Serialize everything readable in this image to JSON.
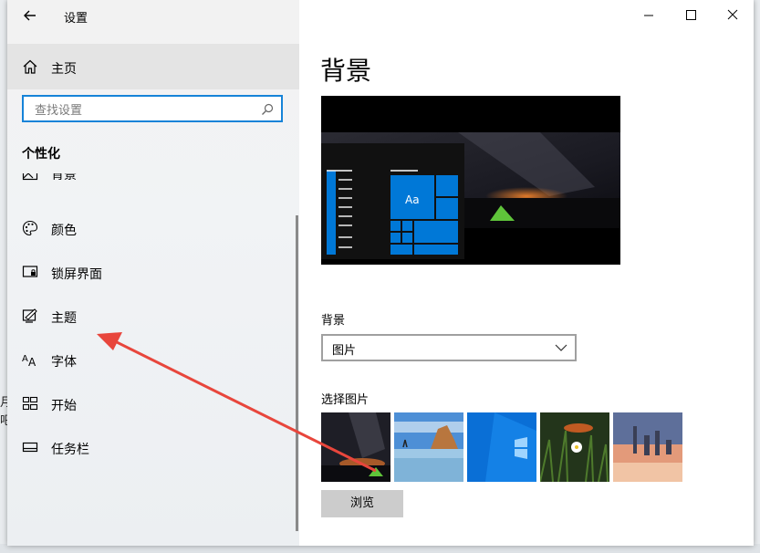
{
  "app": {
    "title": "设置"
  },
  "nav": {
    "home": "主页",
    "section": "个性化",
    "clipped_item": "背景",
    "items": [
      {
        "label": "颜色",
        "icon": "palette-icon"
      },
      {
        "label": "锁屏界面",
        "icon": "lock-screen-icon"
      },
      {
        "label": "主题",
        "icon": "theme-icon"
      },
      {
        "label": "字体",
        "icon": "font-icon"
      },
      {
        "label": "开始",
        "icon": "start-icon"
      },
      {
        "label": "任务栏",
        "icon": "taskbar-icon"
      }
    ]
  },
  "search": {
    "placeholder": "查找设置",
    "value": ""
  },
  "page": {
    "title": "背景",
    "background_label": "背景",
    "background_value": "图片",
    "choose_label": "选择图片",
    "browse": "浏览",
    "preview_tile_text": "Aa"
  },
  "behind": {
    "frag1": "月",
    "frag2": "吧"
  },
  "colors": {
    "accent": "#0078d7",
    "search_border": "#1683d8",
    "arrow": "#e8463c"
  }
}
